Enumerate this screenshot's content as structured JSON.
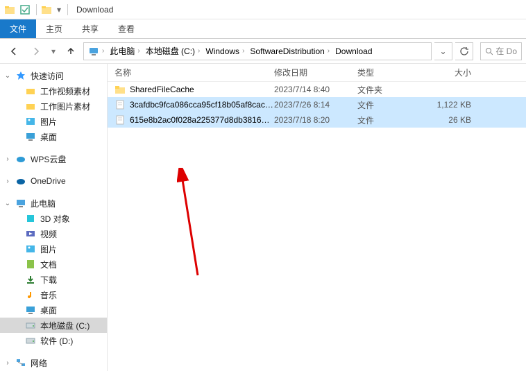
{
  "window": {
    "title": "Download"
  },
  "ribbon": {
    "file": "文件",
    "home": "主页",
    "share": "共享",
    "view": "查看"
  },
  "breadcrumb": {
    "root_icon": "pc",
    "items": [
      "此电脑",
      "本地磁盘 (C:)",
      "Windows",
      "SoftwareDistribution",
      "Download"
    ]
  },
  "search": {
    "placeholder": "在 Do"
  },
  "columns": {
    "name": "名称",
    "date": "修改日期",
    "type": "类型",
    "size": "大小"
  },
  "sidebar": {
    "quick": {
      "label": "快速访问",
      "items": [
        "工作视频素材",
        "工作图片素材",
        "图片",
        "桌面"
      ]
    },
    "wps": {
      "label": "WPS云盘"
    },
    "onedrive": {
      "label": "OneDrive"
    },
    "thispc": {
      "label": "此电脑",
      "items": [
        {
          "label": "3D 对象",
          "icon": "3d"
        },
        {
          "label": "视频",
          "icon": "video"
        },
        {
          "label": "图片",
          "icon": "pictures"
        },
        {
          "label": "文档",
          "icon": "docs"
        },
        {
          "label": "下载",
          "icon": "downloads"
        },
        {
          "label": "音乐",
          "icon": "music"
        },
        {
          "label": "桌面",
          "icon": "desktop"
        },
        {
          "label": "本地磁盘 (C:)",
          "icon": "drive",
          "selected": true
        },
        {
          "label": "软件 (D:)",
          "icon": "drive"
        }
      ]
    },
    "network": {
      "label": "网络"
    }
  },
  "files": [
    {
      "name": "SharedFileCache",
      "date": "2023/7/14 8:40",
      "type": "文件夹",
      "size": "",
      "icon": "folder",
      "selected": false
    },
    {
      "name": "3cafdbc9fca086cca95cf18b05af8cace...",
      "date": "2023/7/26 8:14",
      "type": "文件",
      "size": "1,122 KB",
      "icon": "file",
      "selected": true
    },
    {
      "name": "615e8b2ac0f028a225377d8db381647...",
      "date": "2023/7/18 8:20",
      "type": "文件",
      "size": "26 KB",
      "icon": "file",
      "selected": true
    }
  ]
}
